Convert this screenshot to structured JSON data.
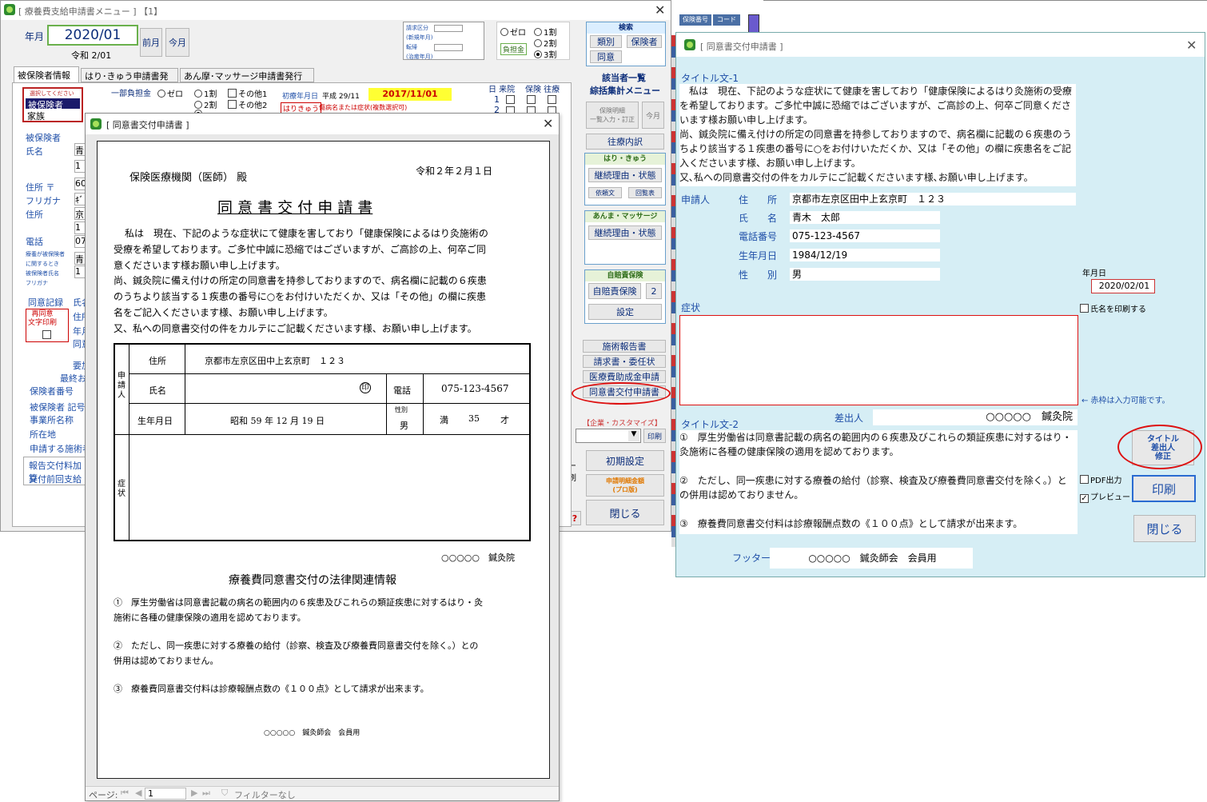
{
  "main_window": {
    "title": "[ 療養費支給申請書メニュー ] 【1】",
    "year_month_label": "年月",
    "year_month_value": "2020/01",
    "reiwa_label": "令和 2/01",
    "prev_button": "前月",
    "current_button": "今月",
    "claim_type_label": "請求区分",
    "claim_sub1": "(新規年月)",
    "claim_sub2": "転帰",
    "claim_sub3": "(治癒年月)",
    "burden_label": "負担金",
    "ratio_options": [
      "ゼロ",
      "1割",
      "2割",
      "3割"
    ],
    "search_title": "検索",
    "search_buttons": [
      "類別",
      "保険者",
      "同意"
    ],
    "list_title1": "該当者一覧",
    "list_title2": "綜括集計メニュー",
    "statement_button": "保険明細\n一覧入力・訂正",
    "this_month": "今月",
    "visit_button": "往療内訳",
    "hari_title": "はり・きゅう",
    "hari_reason": "継続理由・状態",
    "hari_sub1": "依頼文",
    "hari_sub2": "回覧表",
    "anma_title": "あんま・マッサージ",
    "anma_reason": "継続理由・状態",
    "jibai_title": "自賠責保険",
    "jibai_button": "自賠責保険",
    "jibai_num": "2",
    "settings": "設定",
    "report_button": "施術報告書",
    "claim_button": "請求書・委任状",
    "subsidy_button": "医療費助成金申請",
    "consent_button": "同意書交付申請書",
    "custom_label": "【企業・カスタマイズ】",
    "print_small": "印刷",
    "init_settings": "初期設定",
    "detail_amount": "申請明細金額\n(プロ版)",
    "close": "閉じる",
    "help": "?",
    "tabs": [
      "被保険者情報",
      "はり･きゅう申請書発行",
      "あん摩･マッサージ申請書発行"
    ],
    "select_label": "選択してください",
    "select_items": [
      "被保険者",
      "家族"
    ],
    "partial_burden": "一部負担金",
    "first_visit_label": "初療年月日",
    "first_visit_value": "平成 29/11",
    "date_badge": "2017/11/01",
    "hari_tag": "はりきゅう",
    "disease_hint": "傷病名または症状(複数選択可)",
    "other1": "その他1",
    "other2": "その他2",
    "day_header": "日 来院",
    "ins_header": "保険 往療",
    "left_labels": [
      "被保険者",
      "氏名",
      "住所 〒",
      "フリガナ",
      "住所",
      "電話"
    ],
    "left_small": "療養が被保険者\nに関するとき\n被保険者氏名\nフリガナ",
    "consent_record": "同意記録",
    "reconsent": "再同意\n文字印刷",
    "lower_labels": [
      "保険者番号",
      "被保険者 記号",
      "事業所名称",
      "所在地",
      "申請する施術者"
    ],
    "lower_btns": [
      "報告交付料加算",
      "交付前回支給"
    ],
    "need": "要加",
    "final": "最終お",
    "misc": [
      "氏名",
      "住所",
      "年月",
      "同意"
    ],
    "field_values": [
      "青",
      "1",
      "60",
      "ｷﾞ",
      "京",
      "07",
      "1",
      "青",
      "1"
    ],
    "right_clip": [
      "ュー",
      "印刷",
      "い"
    ]
  },
  "preview_window": {
    "title": "[ 同意書交付申請書 ]",
    "addressee": "保険医療機関（医師） 殿",
    "date": "令和２年２月１日",
    "doc_title": "同 意 書 交 付 申 請 書",
    "body_lines": [
      "私は　現在、下記のような症状にて健康を害しており「健康保険によるはり灸施術の",
      "受療を希望しております。ご多忙中誠に恐縮ではございますが、ご高診の上、何卒ご同",
      "意くださいます様お願い申し上げます。",
      "尚、鍼灸院に備え付けの所定の同意書を持参しておりますので、病名欄に記載の６疾患",
      "のうちより該当する１疾患の番号に○をお付けいただくか、又は「その他」の欄に疾患",
      "名をご記入くださいます様、お願い申し上げます。",
      "又、私への同意書交付の件をカルテにご記載くださいます様、お願い申し上げます。"
    ],
    "applicant_label": "申請人",
    "address_label": "住所",
    "address_value": "京都市左京区田中上玄京町　１２３",
    "name_label": "氏名",
    "seal": "印",
    "phone_label": "電話",
    "phone_value": "075-123-4567",
    "birth_label": "生年月日",
    "birth_value": "昭和 59 年 12 月 19 日",
    "sex_label": "性別",
    "sex_value": "男",
    "age_label": "満",
    "age_value": "35",
    "age_unit": "才",
    "symptom_label": "症状",
    "clinic": "○○○○○　鍼灸院",
    "law_title": "療養費同意書交付の法律関連情報",
    "law1a": "①　厚生労働省は同意書記載の病名の範囲内の６疾患及びこれらの類証疾患に対するはり・灸",
    "law1b": "施術に各種の健康保険の適用を認めております。",
    "law2a": "②　ただし、同一疾患に対する療養の給付（診察、検査及び療養費同意書交付を除く。）との",
    "law2b": "併用は認めておりません。",
    "law3": "③　療養費同意書交付料は診療報酬点数の《１００点》として請求が出来ます。",
    "footer": "○○○○○　鍼灸師会　会員用",
    "page_label": "ページ:",
    "page_value": "1",
    "filter": "フィルターなし"
  },
  "dialog": {
    "title": "[ 同意書交付申請書 ]",
    "title1_label": "タイトル文-1",
    "para1": [
      "　私は　現在、下記のような症状にて健康を害しており「健康保険によるはり灸施術の受療",
      "を希望しております。ご多忙中誠に恐縮ではございますが、ご高診の上、何卒ご同意くださ",
      "います様お願い申し上げます。",
      "尚、鍼灸院に備え付けの所定の同意書を持参しておりますので、病名欄に記載の６疾患のう",
      "ちより該当する１疾患の番号に○をお付けいただくか、又は「その他」の欄に疾患名をご記",
      "入くださいます様、お願い申し上げます。",
      "又､私への同意書交付の件をカルテにご記載くださいます様､お願い申し上げます。"
    ],
    "applicant": "申請人",
    "addr_label": "住　　所",
    "addr_value": "京都市左京区田中上玄京町　１２３",
    "name_label": "氏　　名",
    "name_value": "青木　太郎",
    "phone_label": "電話番号",
    "phone_value": "075-123-4567",
    "birth_label": "生年月日",
    "birth_value": "1984/12/19",
    "sex_label": "性　　別",
    "sex_value": "男",
    "date_label": "年月日",
    "date_value": "2020/02/01",
    "print_name": "氏名を印刷する",
    "symptom_label": "症状",
    "red_note": "← 赤枠は入力可能です。",
    "title2_label": "タイトル文-2",
    "sender_label": "差出人",
    "sender_value": "○○○○○　鍼灸院",
    "para2": [
      "①　厚生労働省は同意書記載の病名の範囲内の６疾患及びこれらの類証疾患に対するはり・",
      "灸施術に各種の健康保険の適用を認めております。",
      "",
      "②　ただし、同一疾患に対する療養の給付（診察、検査及び療養費同意書交付を除く。）と",
      "の併用は認めておりません。",
      "",
      "③　療養費同意書交付料は診療報酬点数の《１００点》として請求が出来ます。"
    ],
    "title_fix_btn": "タイトル\n差出人\n修正",
    "pdf_output": "PDF出力",
    "preview": "プレビュー",
    "print": "印刷",
    "close": "閉じる",
    "footer_label": "フッター",
    "footer_value": "○○○○○　鍼灸師会　会員用"
  },
  "strip": {
    "tab1": "保険番号",
    "tab2": "コード"
  }
}
